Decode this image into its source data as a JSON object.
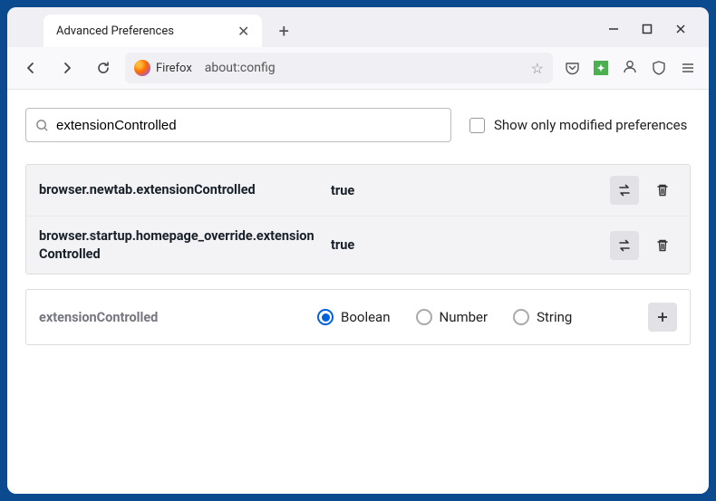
{
  "tab": {
    "title": "Advanced Preferences"
  },
  "address": {
    "brand": "Firefox",
    "url": "about:config"
  },
  "search": {
    "value": "extensionControlled",
    "checkbox_label": "Show only modified preferences"
  },
  "prefs": [
    {
      "name": "browser.newtab.extensionControlled",
      "value": "true"
    },
    {
      "name": "browser.startup.homepage_override.extensionControlled",
      "value": "true"
    }
  ],
  "new_pref": {
    "name": "extensionControlled",
    "types": [
      "Boolean",
      "Number",
      "String"
    ],
    "selected": "Boolean"
  }
}
